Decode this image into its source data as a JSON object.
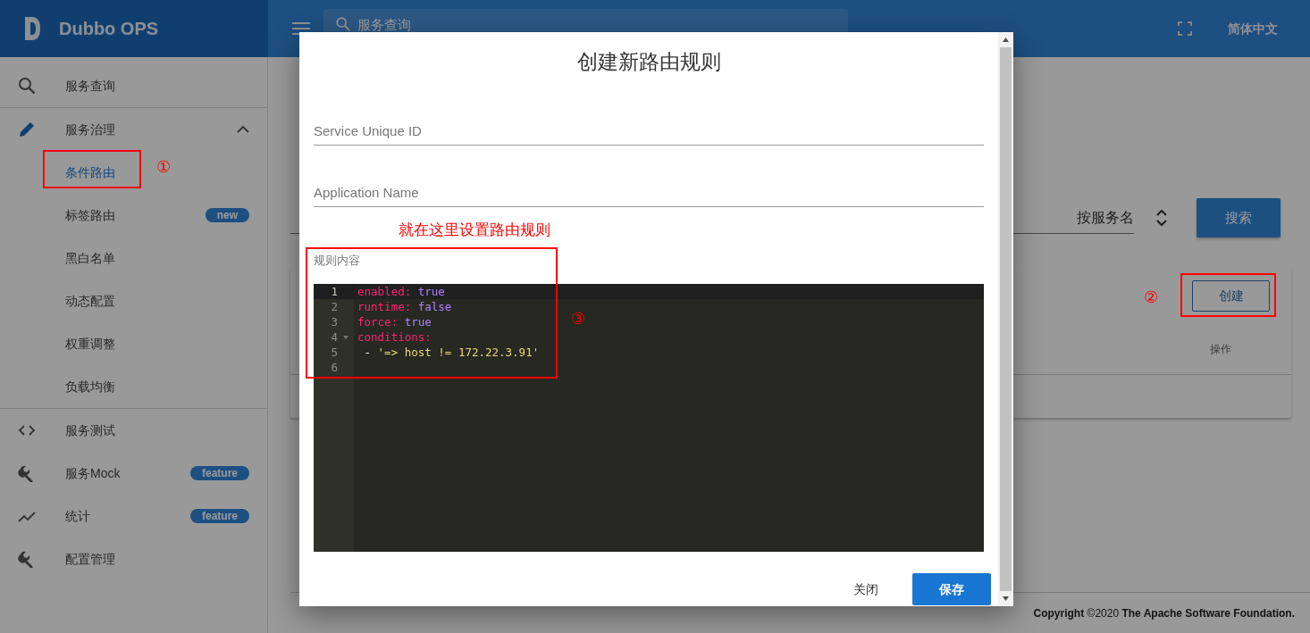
{
  "header": {
    "brand": "Dubbo OPS",
    "search": {
      "placeholder": "服务查询"
    },
    "language": "简体中文"
  },
  "sidebar": {
    "sections": [
      {
        "items": [
          {
            "kind": "item",
            "label": "服务查询",
            "selected": false
          }
        ]
      },
      {
        "items": [
          {
            "kind": "group",
            "label": "服务治理",
            "selected": false,
            "expanded": true,
            "children": [
              {
                "label": "条件路由",
                "selected": true
              },
              {
                "label": "标签路由",
                "selected": false,
                "badge": "new"
              },
              {
                "label": "黑白名单",
                "selected": false
              },
              {
                "label": "动态配置",
                "selected": false
              },
              {
                "label": "权重调整",
                "selected": false
              },
              {
                "label": "负载均衡",
                "selected": false
              }
            ]
          }
        ]
      },
      {
        "items": [
          {
            "kind": "item",
            "label": "服务测试",
            "selected": false
          },
          {
            "kind": "item",
            "label": "服务Mock",
            "selected": false,
            "badge": "feature"
          },
          {
            "kind": "item",
            "label": "统计",
            "selected": false,
            "badge": "feature"
          },
          {
            "kind": "item",
            "label": "配置管理",
            "selected": false
          }
        ]
      }
    ]
  },
  "main": {
    "filter": {
      "value": "按服务名"
    },
    "search_button": "搜索",
    "create_button": "创建",
    "table": {
      "columns": [
        "操作"
      ]
    }
  },
  "footer": "**Copyright** ©2020 **The Apache Software Foundation.**",
  "dialog": {
    "title": "创建新路由规则",
    "fields": [
      {
        "placeholder": "Service Unique ID"
      },
      {
        "placeholder": "Application Name"
      }
    ],
    "editor_label": "规则内容",
    "code_lines": [
      {
        "number": "1",
        "active": true,
        "foldable": false,
        "tokens": [
          {
            "kind": "key",
            "text": "enabled:"
          },
          {
            "kind": "value",
            "text": " true"
          }
        ]
      },
      {
        "number": "2",
        "active": false,
        "foldable": false,
        "tokens": [
          {
            "kind": "key",
            "text": "runtime:"
          },
          {
            "kind": "value",
            "text": " false"
          }
        ]
      },
      {
        "number": "3",
        "active": false,
        "foldable": false,
        "tokens": [
          {
            "kind": "key",
            "text": "force:"
          },
          {
            "kind": "value",
            "text": " true"
          }
        ]
      },
      {
        "number": "4",
        "active": false,
        "foldable": true,
        "tokens": [
          {
            "kind": "key",
            "text": "conditions:"
          }
        ]
      },
      {
        "number": "5",
        "active": false,
        "foldable": false,
        "tokens": [
          {
            "kind": "plain",
            "text": " - "
          },
          {
            "kind": "string",
            "text": "'=> host != 172.22.3.91'"
          }
        ]
      },
      {
        "number": "6",
        "active": false,
        "foldable": false
      }
    ],
    "buttons": [
      {
        "kind": "text",
        "label": "关闭"
      },
      {
        "kind": "primary",
        "label": "保存"
      }
    ]
  },
  "annotations": {
    "note": "就在这里设置路由规则",
    "markers": [
      {
        "text": "①"
      },
      {
        "text": "②"
      },
      {
        "text": "③"
      }
    ]
  }
}
